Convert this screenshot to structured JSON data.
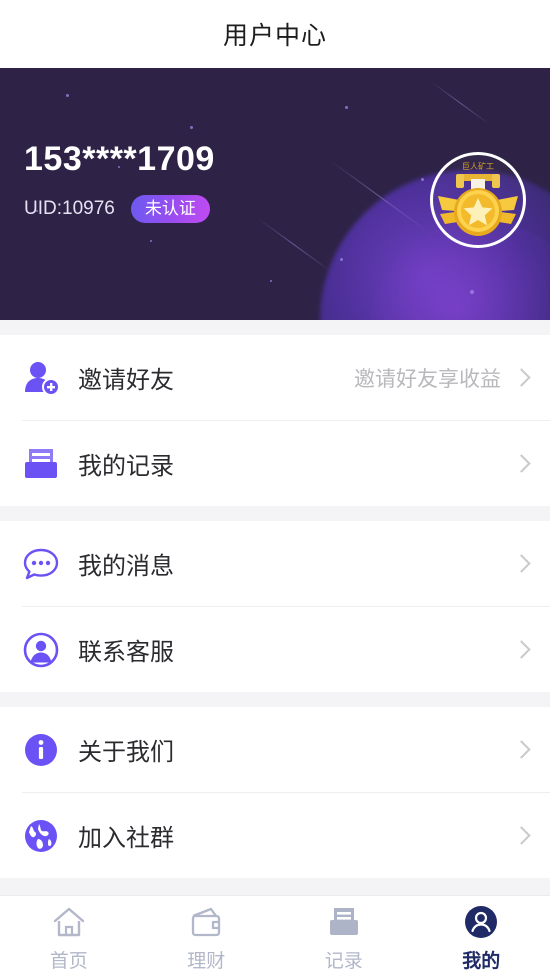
{
  "header": {
    "title": "用户中心"
  },
  "profile": {
    "phone": "153****1709",
    "uid": "UID:10976",
    "verify_badge": "未认证",
    "medal_label": "巨人矿工",
    "badge_gradient_from": "#6a5bf0",
    "badge_gradient_to": "#c24bf2",
    "hero_bg": "#2e2347"
  },
  "groups": [
    {
      "items": [
        {
          "label": "邀请好友",
          "hint": "邀请好友享收益",
          "icon": "user-plus-icon",
          "name": "invite-friends"
        },
        {
          "label": "我的记录",
          "hint": "",
          "icon": "records-tray-icon",
          "name": "my-records"
        }
      ]
    },
    {
      "items": [
        {
          "label": "我的消息",
          "hint": "",
          "icon": "chat-bubble-icon",
          "name": "my-messages"
        },
        {
          "label": "联系客服",
          "hint": "",
          "icon": "support-avatar-icon",
          "name": "contact-support"
        }
      ]
    },
    {
      "items": [
        {
          "label": "关于我们",
          "hint": "",
          "icon": "info-icon",
          "name": "about-us"
        },
        {
          "label": "加入社群",
          "hint": "",
          "icon": "globe-icon",
          "name": "join-community"
        }
      ]
    }
  ],
  "tabbar": {
    "items": [
      {
        "label": "首页",
        "icon": "home-icon",
        "active": false
      },
      {
        "label": "理财",
        "icon": "wallet-icon",
        "active": false
      },
      {
        "label": "记录",
        "icon": "records-icon",
        "active": false
      },
      {
        "label": "我的",
        "icon": "person-icon",
        "active": true
      }
    ],
    "active_color": "#1f2a66",
    "inactive_color": "#b2b7c9"
  },
  "colors": {
    "accent_purple": "#6b52f5",
    "page_bg": "#f4f4f6",
    "text_primary": "#2b2b2f",
    "text_hint": "#b8b8bd"
  }
}
